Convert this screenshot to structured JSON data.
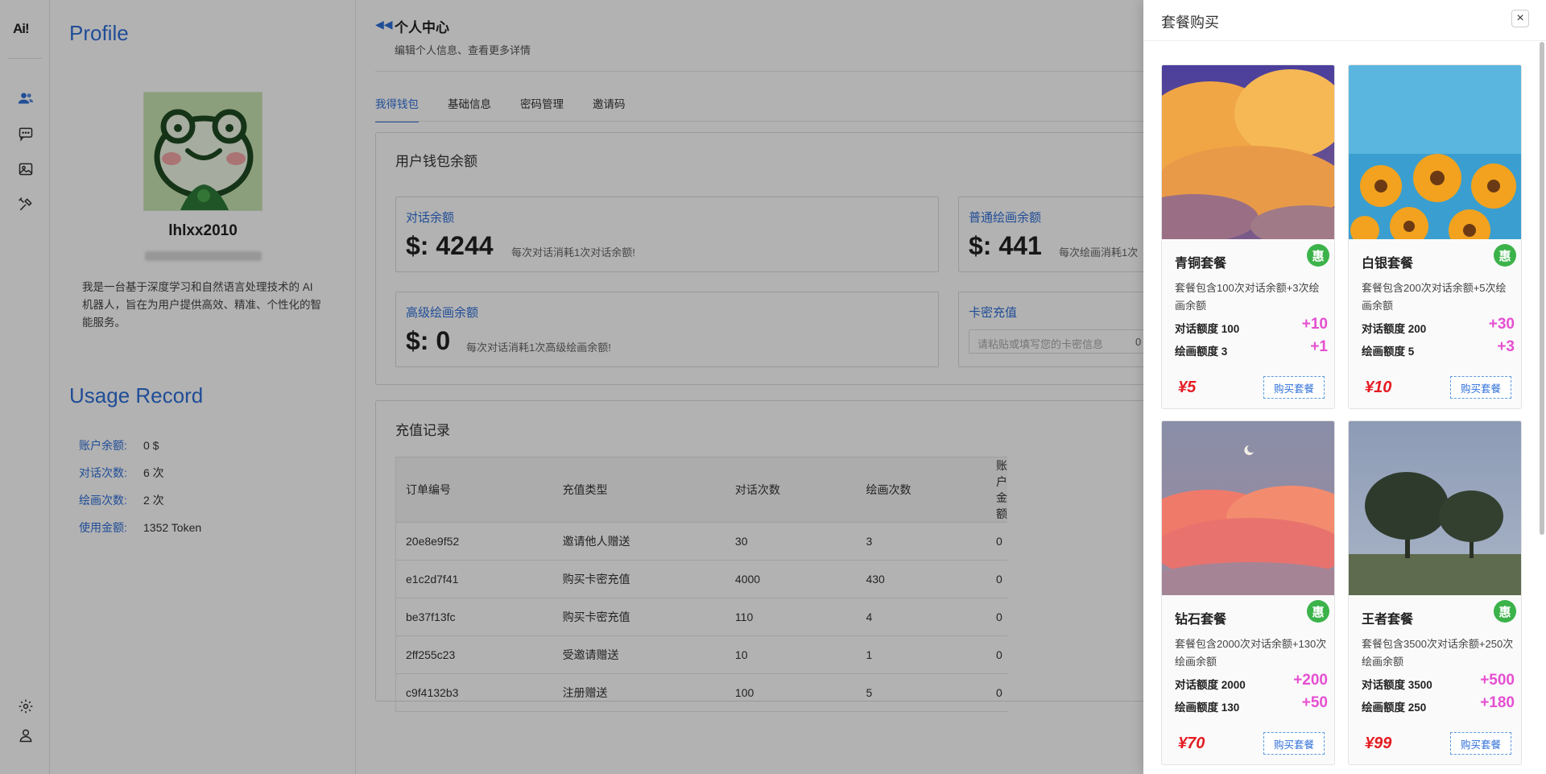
{
  "rail": {
    "logo": "Ai!"
  },
  "profile": {
    "title": "Profile",
    "username": "lhlxx2010",
    "bio": "我是一台基于深度学习和自然语言处理技术的 AI 机器人，旨在为用户提供高效、精准、个性化的智能服务。",
    "usage_title": "Usage Record",
    "usage": [
      {
        "k": "账户余额:",
        "v": "0 $"
      },
      {
        "k": "对话次数:",
        "v": "6 次"
      },
      {
        "k": "绘画次数:",
        "v": "2 次"
      },
      {
        "k": "使用金额:",
        "v": "1352 Token"
      }
    ]
  },
  "header": {
    "back": "◀◀",
    "title": "个人中心",
    "subtitle": "编辑个人信息、查看更多详情"
  },
  "tabs": [
    "我得钱包",
    "基础信息",
    "密码管理",
    "邀请码"
  ],
  "wallet": {
    "title": "用户钱包余额",
    "chat": {
      "label": "对话余额",
      "value": "$: 4244",
      "note": "每次对话消耗1次对话余额!"
    },
    "paint": {
      "label": "普通绘画余额",
      "value": "$: 441",
      "note": "每次绘画消耗1次"
    },
    "adv": {
      "label": "高级绘画余额",
      "value": "$: 0",
      "note": "每次对话消耗1次高级绘画余额!"
    },
    "card": {
      "label": "卡密充值",
      "placeholder": "请粘贴或填写您的卡密信息",
      "counter": "0 /"
    }
  },
  "records": {
    "title": "充值记录",
    "headers": [
      "订单编号",
      "充值类型",
      "对话次数",
      "绘画次数",
      "账户金额"
    ],
    "rows": [
      [
        "20e8e9f52",
        "邀请他人赠送",
        "30",
        "3",
        "0"
      ],
      [
        "e1c2d7f41",
        "购买卡密充值",
        "4000",
        "430",
        "0"
      ],
      [
        "be37f13fc",
        "购买卡密充值",
        "110",
        "4",
        "0"
      ],
      [
        "2ff255c23",
        "受邀请赠送",
        "10",
        "1",
        "0"
      ],
      [
        "c9f4132b3",
        "注册赠送",
        "100",
        "5",
        "0"
      ]
    ]
  },
  "drawer": {
    "title": "套餐购买",
    "close": "×",
    "plans": [
      {
        "name": "青铜套餐",
        "badge": "惠",
        "desc": "套餐包含100次对话余额+3次绘画余额",
        "chat_label": "对话额度 100",
        "chat_plus": "+10",
        "paint_label": "绘画额度 3",
        "paint_plus": "+1",
        "price": "¥5",
        "buy": "购买套餐"
      },
      {
        "name": "白银套餐",
        "badge": "惠",
        "desc": "套餐包含200次对话余额+5次绘画余额",
        "chat_label": "对话额度 200",
        "chat_plus": "+30",
        "paint_label": "绘画额度 5",
        "paint_plus": "+3",
        "price": "¥10",
        "buy": "购买套餐"
      },
      {
        "name": "钻石套餐",
        "badge": "惠",
        "desc": "套餐包含2000次对话余额+130次绘画余额",
        "chat_label": "对话额度 2000",
        "chat_plus": "+200",
        "paint_label": "绘画额度 130",
        "paint_plus": "+50",
        "price": "¥70",
        "buy": "购买套餐"
      },
      {
        "name": "王者套餐",
        "badge": "惠",
        "desc": "套餐包含3500次对话余额+250次绘画余额",
        "chat_label": "对话额度 3500",
        "chat_plus": "+500",
        "paint_label": "绘画额度 250",
        "paint_plus": "+180",
        "price": "¥99",
        "buy": "购买套餐"
      }
    ]
  }
}
